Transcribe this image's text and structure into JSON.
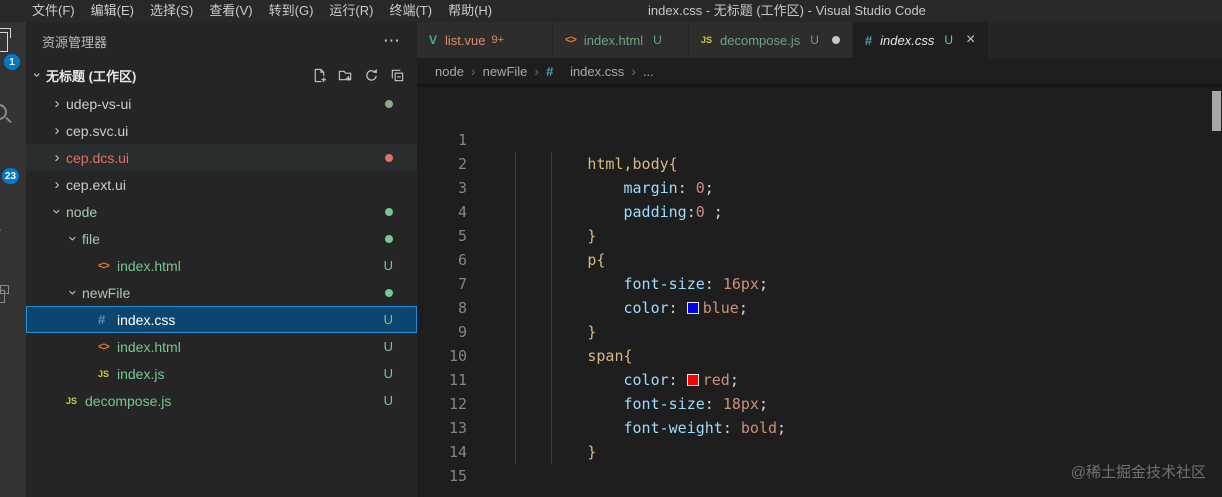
{
  "colors": {
    "accent": "#007acc",
    "untracked": "#73c991",
    "modified": "#e2c08d",
    "deleted": "#e0726a",
    "tok-sel": "#d7ba7d",
    "tok-prop": "#9cdcfe",
    "tok-punct": "#d4d4d4",
    "tok-val": "#ce9178"
  },
  "title_bar": {
    "menus": [
      "文件(F)",
      "编辑(E)",
      "选择(S)",
      "查看(V)",
      "转到(G)",
      "运行(R)",
      "终端(T)",
      "帮助(H)"
    ],
    "title": "index.css - 无标题 (工作区) - Visual Studio Code"
  },
  "activity_bar": {
    "badge_top": "1",
    "badge_mid": "23"
  },
  "sidebar": {
    "title": "资源管理器",
    "more": "⋯",
    "section_label": "无标题 (工作区)",
    "actions": [
      "new-file-icon",
      "new-folder-icon",
      "refresh-icon",
      "collapse-all-icon"
    ],
    "tree": [
      {
        "label": "udep-vs-ui",
        "indent": 0,
        "kind": "folder",
        "arrow": "collapsed",
        "dot": "#8aa88a"
      },
      {
        "label": "cep.svc.ui",
        "indent": 0,
        "kind": "folder",
        "arrow": "collapsed"
      },
      {
        "label": "cep.dcs.ui",
        "indent": 0,
        "kind": "folder",
        "arrow": "collapsed",
        "color": "#e0726a",
        "dot": "#e0726a",
        "hover": true
      },
      {
        "label": "cep.ext.ui",
        "indent": 0,
        "kind": "folder",
        "arrow": "collapsed"
      },
      {
        "label": "node",
        "indent": 0,
        "kind": "folder",
        "arrow": "expanded",
        "color": "#a8c8ab",
        "dot": "#73c991"
      },
      {
        "label": "file",
        "indent": 1,
        "kind": "folder",
        "arrow": "expanded",
        "color": "#a8c8ab",
        "dot": "#73c991"
      },
      {
        "label": "index.html",
        "indent": 2,
        "kind": "file",
        "icon": "html",
        "color": "#73c991",
        "git": "U"
      },
      {
        "label": "newFile",
        "indent": 1,
        "kind": "folder",
        "arrow": "expanded",
        "color": "#a8c8ab",
        "dot": "#73c991"
      },
      {
        "label": "index.css",
        "indent": 2,
        "kind": "file",
        "icon": "css",
        "color": "#ffffff",
        "git": "U",
        "selected": true
      },
      {
        "label": "index.html",
        "indent": 2,
        "kind": "file",
        "icon": "html",
        "color": "#73c991",
        "git": "U"
      },
      {
        "label": "index.js",
        "indent": 2,
        "kind": "file",
        "icon": "js",
        "color": "#73c991",
        "git": "U"
      },
      {
        "label": "decompose.js",
        "indent": 0,
        "kind": "file",
        "icon": "js",
        "color": "#73c991",
        "git": "U"
      }
    ]
  },
  "tabs": [
    {
      "label": "list.vue",
      "icon": "vue",
      "problems": "9+",
      "state": "inactive",
      "label_color": "#e08a6a"
    },
    {
      "label": "index.html",
      "icon": "html",
      "git": "U",
      "state": "inactive",
      "label_color": "#6fa37f"
    },
    {
      "label": "decompose.js",
      "icon": "js",
      "git": "U",
      "state": "inactive",
      "label_color": "#6fa37f",
      "modified": true
    },
    {
      "label": "index.css",
      "icon": "css",
      "git": "U",
      "state": "active",
      "label_color": "#e8e8e8",
      "italic": true,
      "close": true
    }
  ],
  "breadcrumbs": [
    {
      "label": "node"
    },
    {
      "label": "newFile"
    },
    {
      "label": "index.css",
      "icon": "css"
    },
    {
      "label": "..."
    }
  ],
  "editor": {
    "lines": [
      {
        "n": "1",
        "indent": 0,
        "tokens": []
      },
      {
        "n": "2",
        "indent": 12,
        "tokens": [
          {
            "t": "html,body{",
            "c": "sel"
          }
        ]
      },
      {
        "n": "3",
        "indent": 16,
        "tokens": [
          {
            "t": "margin",
            "c": "prop"
          },
          {
            "t": ": ",
            "c": "punct"
          },
          {
            "t": "0",
            "c": "val"
          },
          {
            "t": ";",
            "c": "punct"
          }
        ]
      },
      {
        "n": "4",
        "indent": 16,
        "tokens": [
          {
            "t": "padding",
            "c": "prop"
          },
          {
            "t": ":",
            "c": "punct"
          },
          {
            "t": "0",
            "c": "val"
          },
          {
            "t": " ;",
            "c": "punct"
          }
        ]
      },
      {
        "n": "5",
        "indent": 12,
        "tokens": [
          {
            "t": "}",
            "c": "sel"
          }
        ]
      },
      {
        "n": "6",
        "indent": 12,
        "tokens": [
          {
            "t": "p{",
            "c": "sel"
          }
        ]
      },
      {
        "n": "7",
        "indent": 16,
        "tokens": [
          {
            "t": "font-size",
            "c": "prop"
          },
          {
            "t": ": ",
            "c": "punct"
          },
          {
            "t": "16px",
            "c": "val"
          },
          {
            "t": ";",
            "c": "punct"
          }
        ]
      },
      {
        "n": "8",
        "indent": 16,
        "tokens": [
          {
            "t": "color",
            "c": "prop"
          },
          {
            "t": ": ",
            "c": "punct"
          },
          {
            "swatch": "#0000ff"
          },
          {
            "t": "blue",
            "c": "val"
          },
          {
            "t": ";",
            "c": "punct"
          }
        ]
      },
      {
        "n": "9",
        "indent": 12,
        "tokens": [
          {
            "t": "}",
            "c": "sel"
          }
        ]
      },
      {
        "n": "10",
        "indent": 12,
        "tokens": [
          {
            "t": "span{",
            "c": "sel"
          }
        ]
      },
      {
        "n": "11",
        "indent": 16,
        "tokens": [
          {
            "t": "color",
            "c": "prop"
          },
          {
            "t": ": ",
            "c": "punct"
          },
          {
            "swatch": "#ff0000"
          },
          {
            "t": "red",
            "c": "val"
          },
          {
            "t": ";",
            "c": "punct"
          }
        ]
      },
      {
        "n": "12",
        "indent": 16,
        "tokens": [
          {
            "t": "font-size",
            "c": "prop"
          },
          {
            "t": ": ",
            "c": "punct"
          },
          {
            "t": "18px",
            "c": "val"
          },
          {
            "t": ";",
            "c": "punct"
          }
        ]
      },
      {
        "n": "13",
        "indent": 16,
        "tokens": [
          {
            "t": "font-weight",
            "c": "prop"
          },
          {
            "t": ": ",
            "c": "punct"
          },
          {
            "t": "bold",
            "c": "val"
          },
          {
            "t": ";",
            "c": "punct"
          }
        ]
      },
      {
        "n": "14",
        "indent": 12,
        "tokens": [
          {
            "t": "}",
            "c": "sel"
          }
        ]
      },
      {
        "n": "15",
        "indent": 0,
        "tokens": []
      }
    ],
    "watermark": "@稀土掘金技术社区"
  }
}
